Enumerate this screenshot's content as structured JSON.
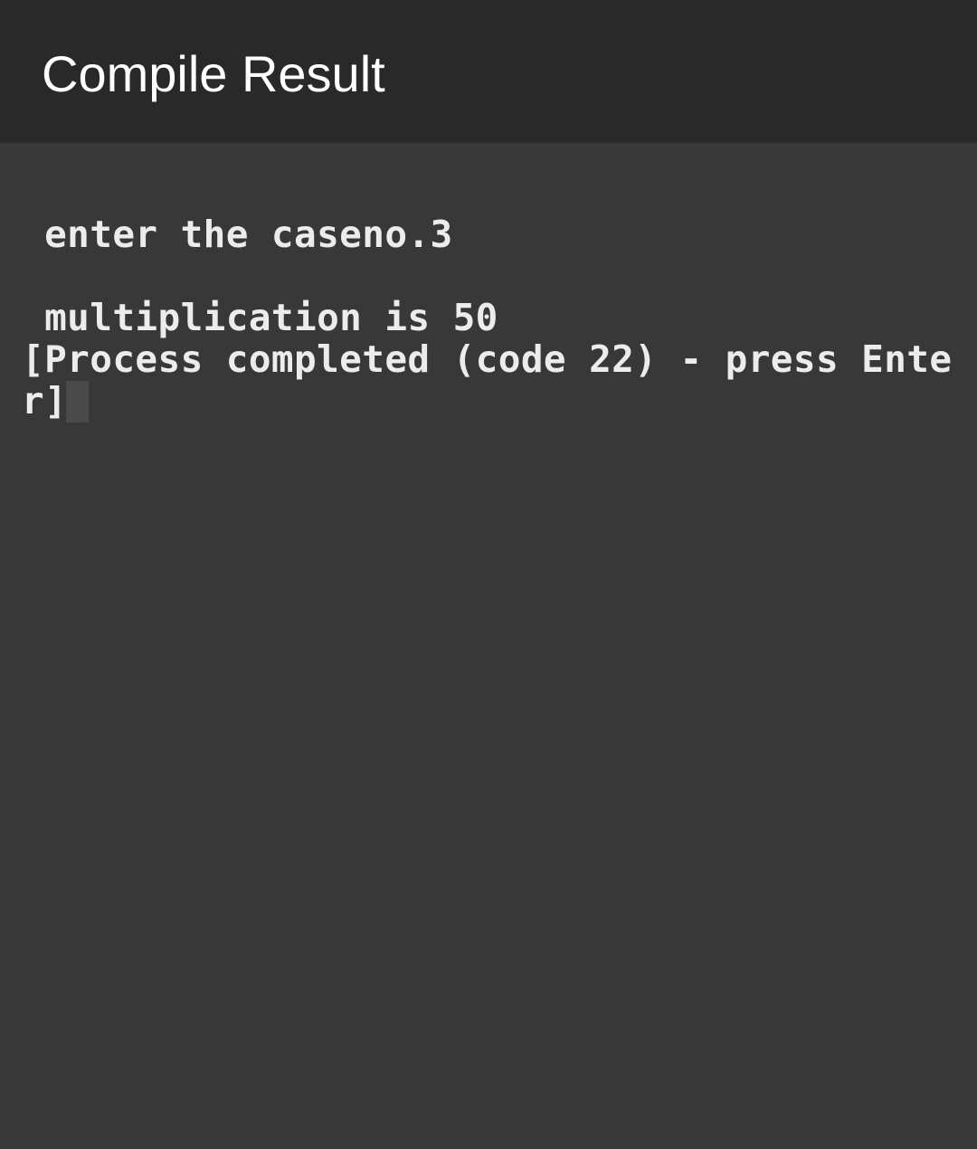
{
  "app_bar": {
    "title": "Compile Result"
  },
  "terminal": {
    "lines": [
      " enter the caseno.3",
      "",
      " multiplication is 50",
      "[Process completed (code 22) - press Ente",
      "r]"
    ],
    "background_color": "#383838",
    "text_color": "#ececec"
  }
}
